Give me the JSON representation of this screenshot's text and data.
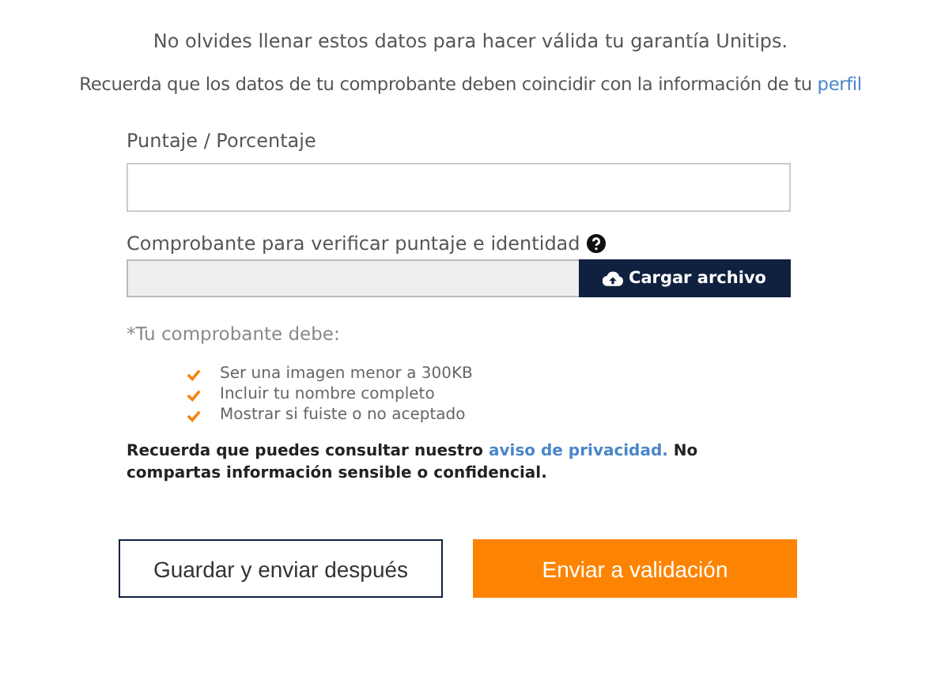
{
  "intro": "No olvides llenar estos datos para hacer válida tu garantía Unitips.",
  "profile_note": {
    "text": "Recuerda que los datos de tu comprobante deben coincidir con la información de tu",
    "link": "perfil"
  },
  "score_field": {
    "label": "Puntaje / Porcentaje"
  },
  "file_field": {
    "label": "Comprobante para verificar puntaje e identidad",
    "button": "Cargar archivo"
  },
  "requirements": {
    "title": "*Tu comprobante debe:",
    "items": [
      "Ser una imagen menor a 300KB",
      "Incluir tu nombre completo",
      "Mostrar si fuiste o no aceptado"
    ]
  },
  "privacy": {
    "before": "Recuerda que puedes consultar nuestro",
    "link": "aviso de privacidad.",
    "after": "No compartas información sensible o confidencial."
  },
  "buttons": [
    {
      "label": "Guardar y enviar después",
      "kind": "secondary"
    },
    {
      "label": "Enviar a validación",
      "kind": "primary"
    }
  ]
}
